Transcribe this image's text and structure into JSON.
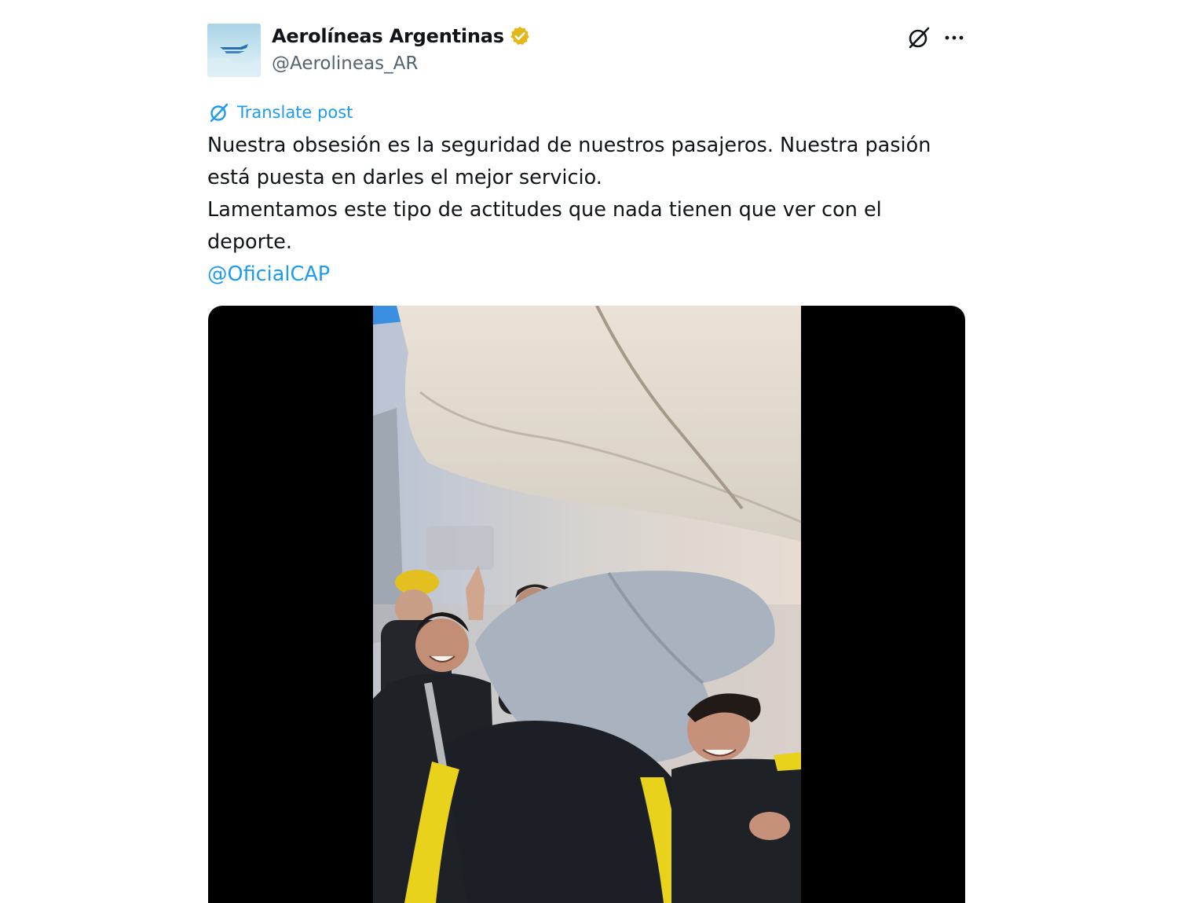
{
  "account": {
    "display_name": "Aerolíneas Argentinas",
    "handle": "@Aerolineas_AR",
    "verified_badge_color": "#e2b719"
  },
  "actions": {
    "grok_icon": "grok-icon",
    "more_icon": "more-horizontal-icon"
  },
  "translate": {
    "label": "Translate post",
    "icon": "grok-translate-icon"
  },
  "post": {
    "paragraphs": [
      "Nuestra obsesión es la seguridad de nuestros pasajeros. Nuestra pasión está puesta en darles el mejor servicio.",
      "Lamentamos este tipo de actitudes que nada tienen que ver con el deporte."
    ],
    "mention": "@OficialCAP"
  },
  "colors": {
    "link": "#1d9bf0",
    "text": "#0f1419",
    "secondary": "#536471",
    "media_bg": "#000000"
  }
}
